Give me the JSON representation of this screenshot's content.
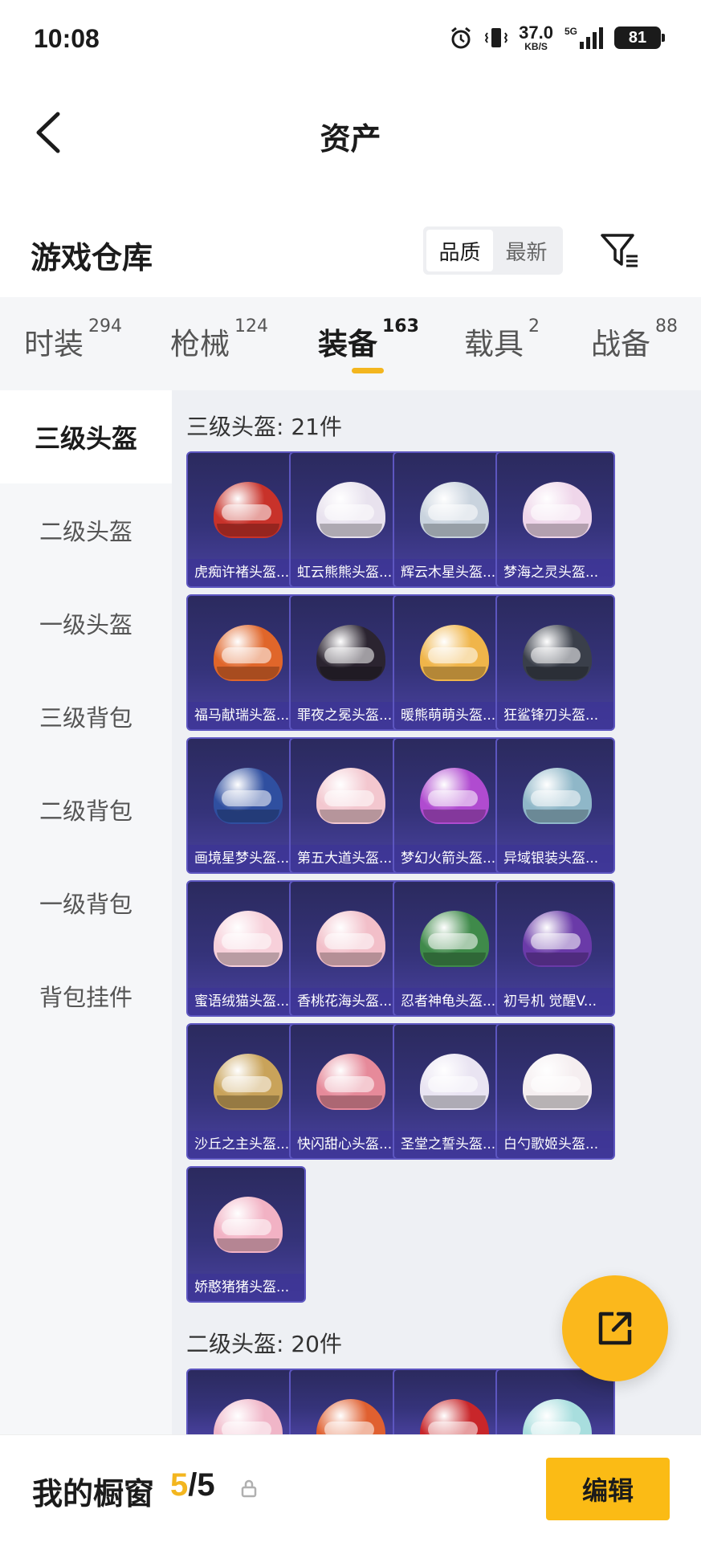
{
  "status_bar": {
    "time": "10:08",
    "net_speed": "37.0",
    "net_unit": "KB/S",
    "signal_label": "5G",
    "battery": "81"
  },
  "header": {
    "title": "资产"
  },
  "section": {
    "title": "游戏仓库",
    "sort_options": [
      "品质",
      "最新"
    ],
    "sort_selected": "品质"
  },
  "tabs": [
    {
      "label": "时装",
      "count": "294"
    },
    {
      "label": "枪械",
      "count": "124"
    },
    {
      "label": "装备",
      "count": "163",
      "active": true
    },
    {
      "label": "载具",
      "count": "2"
    },
    {
      "label": "战备",
      "count": "88"
    }
  ],
  "sidebar": [
    {
      "label": "三级头盔",
      "active": true
    },
    {
      "label": "二级头盔"
    },
    {
      "label": "一级头盔"
    },
    {
      "label": "三级背包"
    },
    {
      "label": "二级背包"
    },
    {
      "label": "一级背包"
    },
    {
      "label": "背包挂件"
    }
  ],
  "groups": [
    {
      "title": "三级头盔: 21件",
      "items": [
        {
          "name": "虎痴许褚头盔...",
          "color": "#c8322a"
        },
        {
          "name": "虹云熊熊头盔...",
          "color": "#e8e2ee"
        },
        {
          "name": "辉云木星头盔...",
          "color": "#c9d3de"
        },
        {
          "name": "梦海之灵头盔...",
          "color": "#efd6ea"
        },
        {
          "name": "福马献瑞头盔...",
          "color": "#e0662a"
        },
        {
          "name": "罪夜之冕头盔...",
          "color": "#2b2430"
        },
        {
          "name": "暖熊萌萌头盔...",
          "color": "#f0b54a"
        },
        {
          "name": "狂鲨锋刃头盔...",
          "color": "#3a3f4a"
        },
        {
          "name": "画境星梦头盔...",
          "color": "#2f4fa0"
        },
        {
          "name": "第五大道头盔...",
          "color": "#f3c7cf"
        },
        {
          "name": "梦幻火箭头盔...",
          "color": "#b04bd0"
        },
        {
          "name": "异域银装头盔...",
          "color": "#8fb7c8"
        },
        {
          "name": "蜜语绒猫头盔...",
          "color": "#f7d0da"
        },
        {
          "name": "香桃花海头盔...",
          "color": "#f2bfc9"
        },
        {
          "name": "忍者神龟头盔...",
          "color": "#3f8a4a"
        },
        {
          "name": "初号机 觉醒V...",
          "color": "#6a3aa8"
        },
        {
          "name": "沙丘之主头盔...",
          "color": "#c9a35a"
        },
        {
          "name": "快闪甜心头盔...",
          "color": "#e68a9a"
        },
        {
          "name": "圣堂之誓头盔...",
          "color": "#e9e4f2"
        },
        {
          "name": "白勺歌姬头盔...",
          "color": "#f5eef0"
        },
        {
          "name": "娇憨猪猪头盔...",
          "color": "#f2b2c4"
        }
      ]
    },
    {
      "title": "二级头盔: 20件",
      "items": [
        {
          "name": "",
          "color": "#f0b6c8"
        },
        {
          "name": "",
          "color": "#e06030"
        },
        {
          "name": "",
          "color": "#c8262a"
        },
        {
          "name": "",
          "color": "#a8dede"
        }
      ]
    }
  ],
  "bottom_bar": {
    "label": "我的橱窗",
    "current": "5",
    "total": "/5",
    "edit_label": "编辑"
  },
  "colors": {
    "accent": "#fbb81c",
    "card_bg": "#35337a"
  },
  "icons": [
    "back-arrow-icon",
    "filter-icon",
    "share-icon",
    "lock-icon",
    "alarm-icon",
    "vibrate-icon",
    "signal-icon"
  ]
}
